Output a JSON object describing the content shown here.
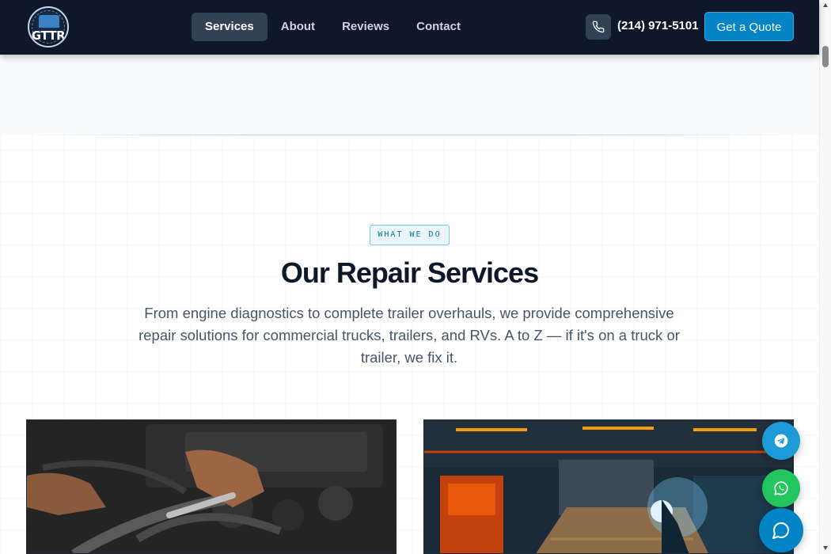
{
  "brand": {
    "logo_text": "GTTR",
    "logo_icon": "truck-logo-icon"
  },
  "nav": {
    "links": [
      "Services",
      "About",
      "Reviews",
      "Contact"
    ],
    "active": "Services",
    "phone_icon": "phone-icon",
    "phone": "(214) 971-5101",
    "cta_label": "Get a Quote"
  },
  "section": {
    "eyebrow": "WHAT WE DO",
    "title": "Our Repair Services",
    "description": "From engine diagnostics to complete trailer overhauls, we provide comprehensive repair solutions for commercial trucks, trailers, and RVs. A to Z — if it's on a truck or trailer, we fix it."
  },
  "cards": [
    {
      "image": "engine-repair-photo"
    },
    {
      "image": "welding-workshop-photo"
    }
  ],
  "floating": {
    "telegram_icon": "telegram-icon",
    "whatsapp_icon": "whatsapp-icon",
    "chat_icon": "chat-bubble-icon"
  },
  "colors": {
    "navbar": "#0f172a",
    "accent": "#0284c7",
    "nav_active": "#334155",
    "title": "#0f172a",
    "body_text": "#475569",
    "whatsapp": "#22c55e",
    "telegram": "#1d9bd8"
  }
}
